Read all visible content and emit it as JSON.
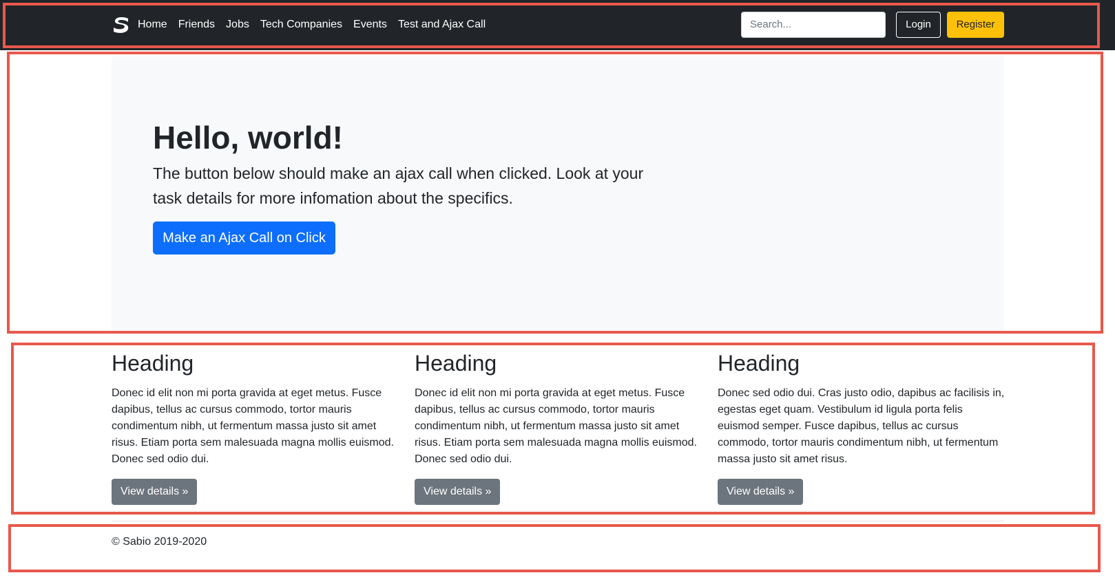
{
  "navbar": {
    "brand_icon": "sabio-logo-icon",
    "links": [
      "Home",
      "Friends",
      "Jobs",
      "Tech Companies",
      "Events",
      "Test and Ajax Call"
    ],
    "search_placeholder": "Search...",
    "login_label": "Login",
    "register_label": "Register"
  },
  "hero": {
    "title": "Hello, world!",
    "lead": "The button below should make an ajax call when clicked. Look at your task details for more infomation about the specifics.",
    "button_label": "Make an Ajax Call on Click"
  },
  "columns": [
    {
      "heading": "Heading",
      "text": "Donec id elit non mi porta gravida at eget metus. Fusce dapibus, tellus ac cursus commodo, tortor mauris condimentum nibh, ut fermentum massa justo sit amet risus. Etiam porta sem malesuada magna mollis euismod. Donec sed odio dui.",
      "button_label": "View details »"
    },
    {
      "heading": "Heading",
      "text": "Donec id elit non mi porta gravida at eget metus. Fusce dapibus, tellus ac cursus commodo, tortor mauris condimentum nibh, ut fermentum massa justo sit amet risus. Etiam porta sem malesuada magna mollis euismod. Donec sed odio dui.",
      "button_label": "View details »"
    },
    {
      "heading": "Heading",
      "text": "Donec sed odio dui. Cras justo odio, dapibus ac facilisis in, egestas eget quam. Vestibulum id ligula porta felis euismod semper. Fusce dapibus, tellus ac cursus commodo, tortor mauris condimentum nibh, ut fermentum massa justo sit amet risus.",
      "button_label": "View details »"
    }
  ],
  "footer": {
    "copyright": "© Sabio 2019-2020"
  },
  "colors": {
    "navbar_bg": "#212529",
    "primary": "#0d6efd",
    "warning": "#ffc107",
    "secondary": "#6c757d",
    "hero_bg": "#f8f9fa",
    "annotation_outline": "#e8584c"
  }
}
